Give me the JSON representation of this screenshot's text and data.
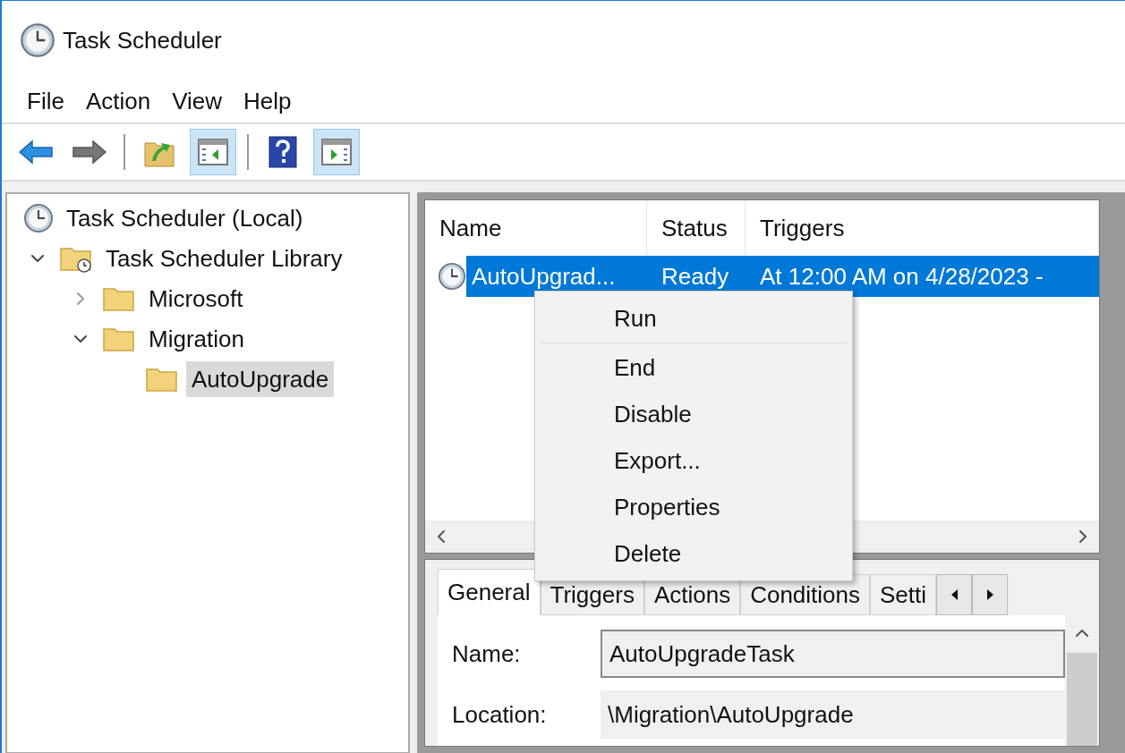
{
  "window": {
    "title": "Task Scheduler"
  },
  "menu": [
    "File",
    "Action",
    "View",
    "Help"
  ],
  "toolbar": [
    {
      "kind": "back",
      "pressed": false
    },
    {
      "kind": "forward",
      "pressed": false
    },
    {
      "kind": "sep"
    },
    {
      "kind": "up",
      "pressed": false
    },
    {
      "kind": "tree",
      "pressed": true
    },
    {
      "kind": "sep"
    },
    {
      "kind": "help",
      "pressed": false
    },
    {
      "kind": "actions",
      "pressed": true
    }
  ],
  "tree": [
    {
      "label": "Task Scheduler (Local)",
      "kind": "clock",
      "selected": false,
      "children": [
        {
          "label": "Task Scheduler Library",
          "kind": "library",
          "expanded": true,
          "selected": false,
          "children": [
            {
              "label": "Microsoft",
              "kind": "folder",
              "expanded": false,
              "selected": false
            },
            {
              "label": "Migration",
              "kind": "folder",
              "expanded": true,
              "selected": false,
              "children": [
                {
                  "label": "AutoUpgrade",
                  "kind": "folder",
                  "selected": true
                }
              ]
            }
          ]
        }
      ]
    }
  ],
  "task_list": {
    "columns": [
      "Name",
      "Status",
      "Triggers"
    ],
    "rows": [
      {
        "name": "AutoUpgrad...",
        "status": "Ready",
        "triggers": "At 12:00 AM on 4/28/2023 -",
        "selected": true
      }
    ]
  },
  "context_menu": [
    {
      "label": "Run",
      "separator_after": true
    },
    {
      "label": "End",
      "separator_after": false
    },
    {
      "label": "Disable",
      "separator_after": false
    },
    {
      "label": "Export...",
      "separator_after": false
    },
    {
      "label": "Properties",
      "separator_after": false
    },
    {
      "label": "Delete",
      "separator_after": false
    }
  ],
  "details": {
    "tabs": [
      {
        "label": "General",
        "selected": true
      },
      {
        "label": "Triggers",
        "selected": false
      },
      {
        "label": "Actions",
        "selected": false
      },
      {
        "label": "Conditions",
        "selected": false
      },
      {
        "label": "Setti",
        "selected": false
      }
    ],
    "fields": [
      {
        "label": "Name:",
        "value": "AutoUpgradeTask",
        "readonly": false
      },
      {
        "label": "Location:",
        "value": "\\Migration\\AutoUpgrade",
        "readonly": true
      }
    ]
  }
}
